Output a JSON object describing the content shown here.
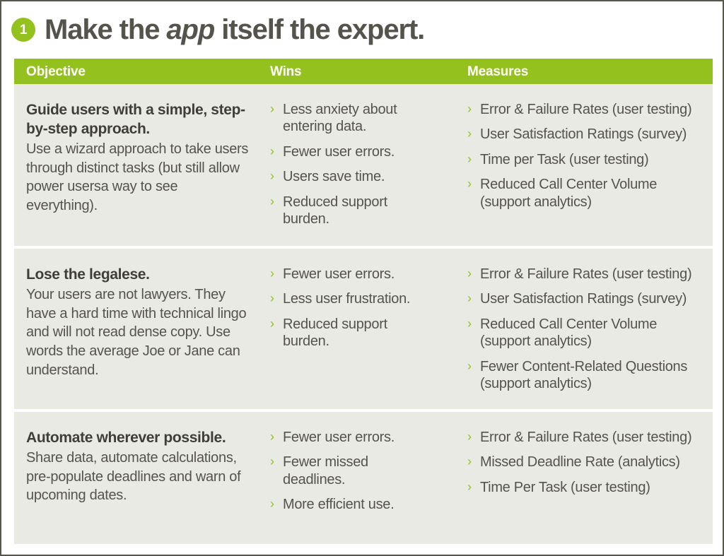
{
  "header": {
    "badge_number": "1",
    "title_prefix": "Make the ",
    "title_emphasis": "app",
    "title_suffix": " itself the expert."
  },
  "colors": {
    "accent_green": "#95c11f",
    "row_background": "#eaeae5",
    "text_dark": "#55544c",
    "border": "#57564e"
  },
  "table": {
    "columns": [
      "Objective",
      "Wins",
      "Measures"
    ],
    "rows": [
      {
        "objective_title": "Guide users with a simple, step-by-step approach.",
        "objective_desc": "Use a wizard approach to take users through distinct tasks (but still allow power usersa way to see everything).",
        "wins": [
          "Less anxiety about entering data.",
          "Fewer user errors.",
          "Users save time.",
          "Reduced support burden."
        ],
        "measures": [
          "Error & Failure Rates (user testing)",
          "User Satisfaction Ratings (survey)",
          "Time per Task (user testing)",
          "Reduced Call Center Volume (support analytics)"
        ]
      },
      {
        "objective_title": "Lose the legalese.",
        "objective_desc": "Your users are not lawyers. They have a hard time with technical lingo and will not read dense copy. Use words the average Joe or Jane can understand.",
        "wins": [
          "Fewer user errors.",
          "Less user frustration.",
          "Reduced support burden."
        ],
        "measures": [
          "Error & Failure Rates (user testing)",
          "User Satisfaction Ratings (survey)",
          "Reduced Call Center Volume (support analytics)",
          "Fewer Content-Related Questions (support analytics)"
        ]
      },
      {
        "objective_title": "Automate wherever possible.",
        "objective_desc": "Share data, automate calculations, pre-populate deadlines and warn of upcoming dates.",
        "wins": [
          "Fewer user errors.",
          "Fewer missed deadlines.",
          "More efficient use."
        ],
        "measures": [
          "Error & Failure Rates (user testing)",
          "Missed Deadline Rate (analytics)",
          "Time Per Task (user testing)"
        ]
      }
    ]
  },
  "icons": {
    "bullet": "›"
  }
}
